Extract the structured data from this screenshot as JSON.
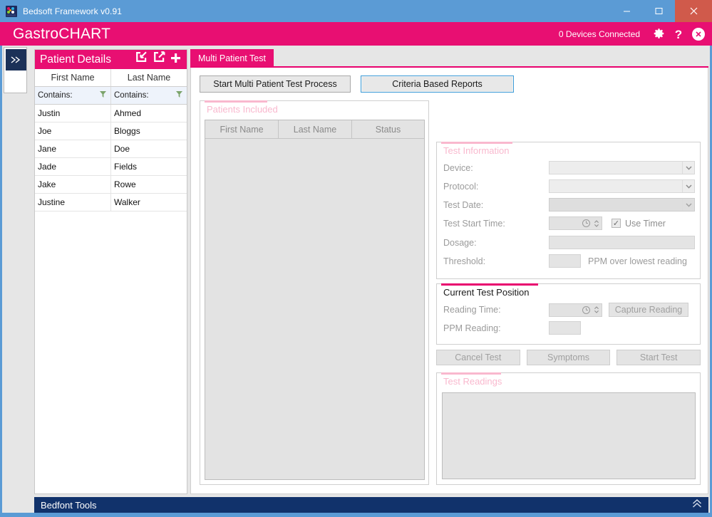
{
  "window": {
    "title": "Bedsoft Framework v0.91",
    "app_icon": "bedsoft-logo-icon",
    "controls": {
      "minimize": "minimize-icon",
      "maximize": "maximize-icon",
      "close": "close-icon"
    }
  },
  "header": {
    "brand": "GastroCHART",
    "devices_connected": "0 Devices Connected",
    "settings_icon": "gear-icon",
    "help_icon": "question-mark-icon",
    "close_icon": "close-circle-icon",
    "accent_color": "#e80f72"
  },
  "rail": {
    "expand_icon": "double-chevron-right-icon"
  },
  "patients": {
    "title": "Patient Details",
    "icons": {
      "import": "import-icon",
      "export": "export-icon",
      "add": "plus-icon"
    },
    "columns": [
      "First Name",
      "Last Name"
    ],
    "filter": {
      "first_name": "Contains:",
      "last_name": "Contains:",
      "icon": "funnel-icon"
    },
    "rows": [
      {
        "first": "Justin",
        "last": "Ahmed"
      },
      {
        "first": "Joe",
        "last": "Bloggs"
      },
      {
        "first": "Jane",
        "last": "Doe"
      },
      {
        "first": "Jade",
        "last": "Fields"
      },
      {
        "first": "Jake",
        "last": "Rowe"
      },
      {
        "first": "Justine",
        "last": "Walker"
      }
    ]
  },
  "main": {
    "tab": "Multi Patient Test",
    "buttons": {
      "start_process": "Start Multi Patient Test Process",
      "criteria_reports": "Criteria Based Reports"
    },
    "patients_included": {
      "title": "Patients Included",
      "columns": [
        "First Name",
        "Last Name",
        "Status"
      ],
      "rows": []
    },
    "test_information": {
      "title": "Test Information",
      "device_label": "Device:",
      "device_value": "",
      "protocol_label": "Protocol:",
      "protocol_value": "",
      "test_date_label": "Test Date:",
      "test_date_value": "",
      "test_start_time_label": "Test Start Time:",
      "test_start_time_value": "",
      "use_timer_label": "Use Timer",
      "use_timer_checked": "✓",
      "dosage_label": "Dosage:",
      "dosage_value": "",
      "threshold_label": "Threshold:",
      "threshold_value": "",
      "threshold_unit": "PPM over lowest reading",
      "clock_icon": "clock-icon",
      "spinner_icon": "up-down-spinner-icon",
      "dropdown_icon": "chevron-down-icon"
    },
    "current_test_position": {
      "title": "Current Test Position",
      "reading_time_label": "Reading Time:",
      "reading_time_value": "",
      "capture_reading": "Capture Reading",
      "ppm_reading_label": "PPM Reading:",
      "ppm_reading_value": ""
    },
    "actions": {
      "cancel_test": "Cancel Test",
      "symptoms": "Symptoms",
      "start_test": "Start Test"
    },
    "test_readings": {
      "title": "Test Readings",
      "content": ""
    }
  },
  "statusbar": {
    "label": "Bedfont Tools",
    "collapse_icon": "double-chevron-up-icon"
  }
}
